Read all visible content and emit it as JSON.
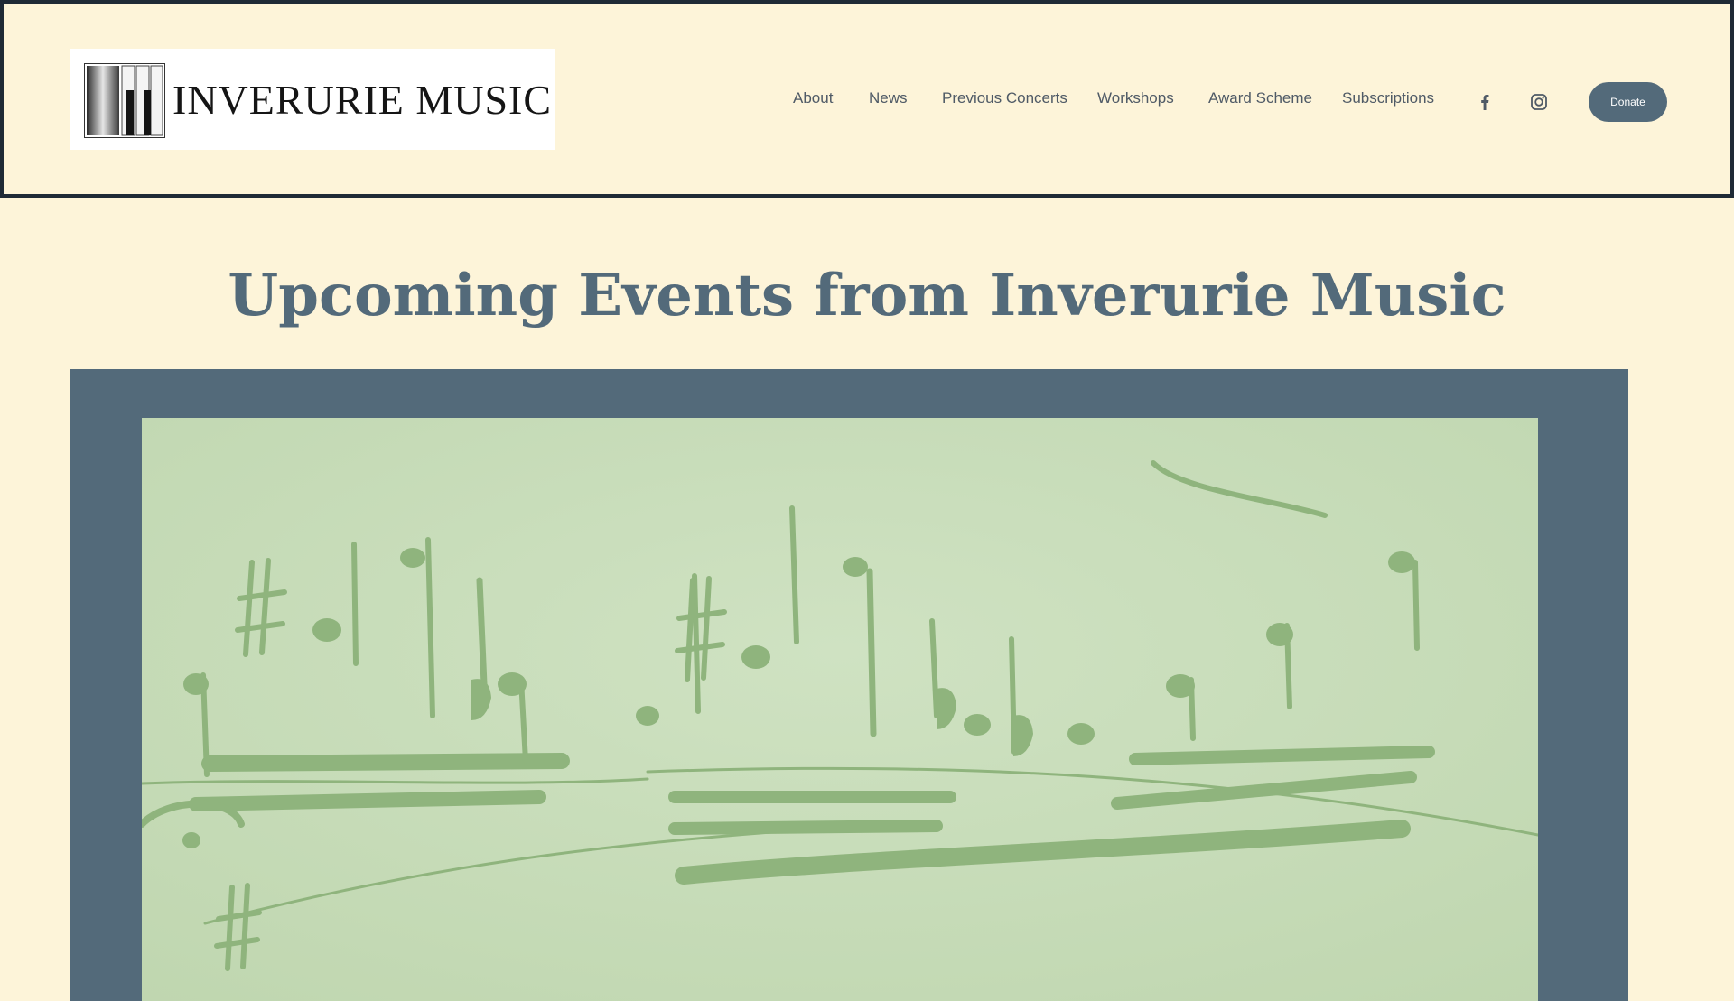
{
  "brand": {
    "name": "INVERURIE MUSIC"
  },
  "nav": {
    "items": [
      {
        "label": "About"
      },
      {
        "label": "News"
      },
      {
        "label": "Previous Concerts"
      },
      {
        "label": "Workshops"
      },
      {
        "label": "Award Scheme"
      },
      {
        "label": "Subscriptions"
      }
    ],
    "social": [
      "facebook-icon",
      "instagram-icon"
    ],
    "donate_label": "Donate"
  },
  "main": {
    "title": "Upcoming Events from Inverurie Music"
  },
  "colors": {
    "background": "#fdf4d9",
    "accent": "#536a7a",
    "header_border": "#1f2a36",
    "image_tint": "#c6dbb8",
    "notation": "#8fb47d"
  }
}
